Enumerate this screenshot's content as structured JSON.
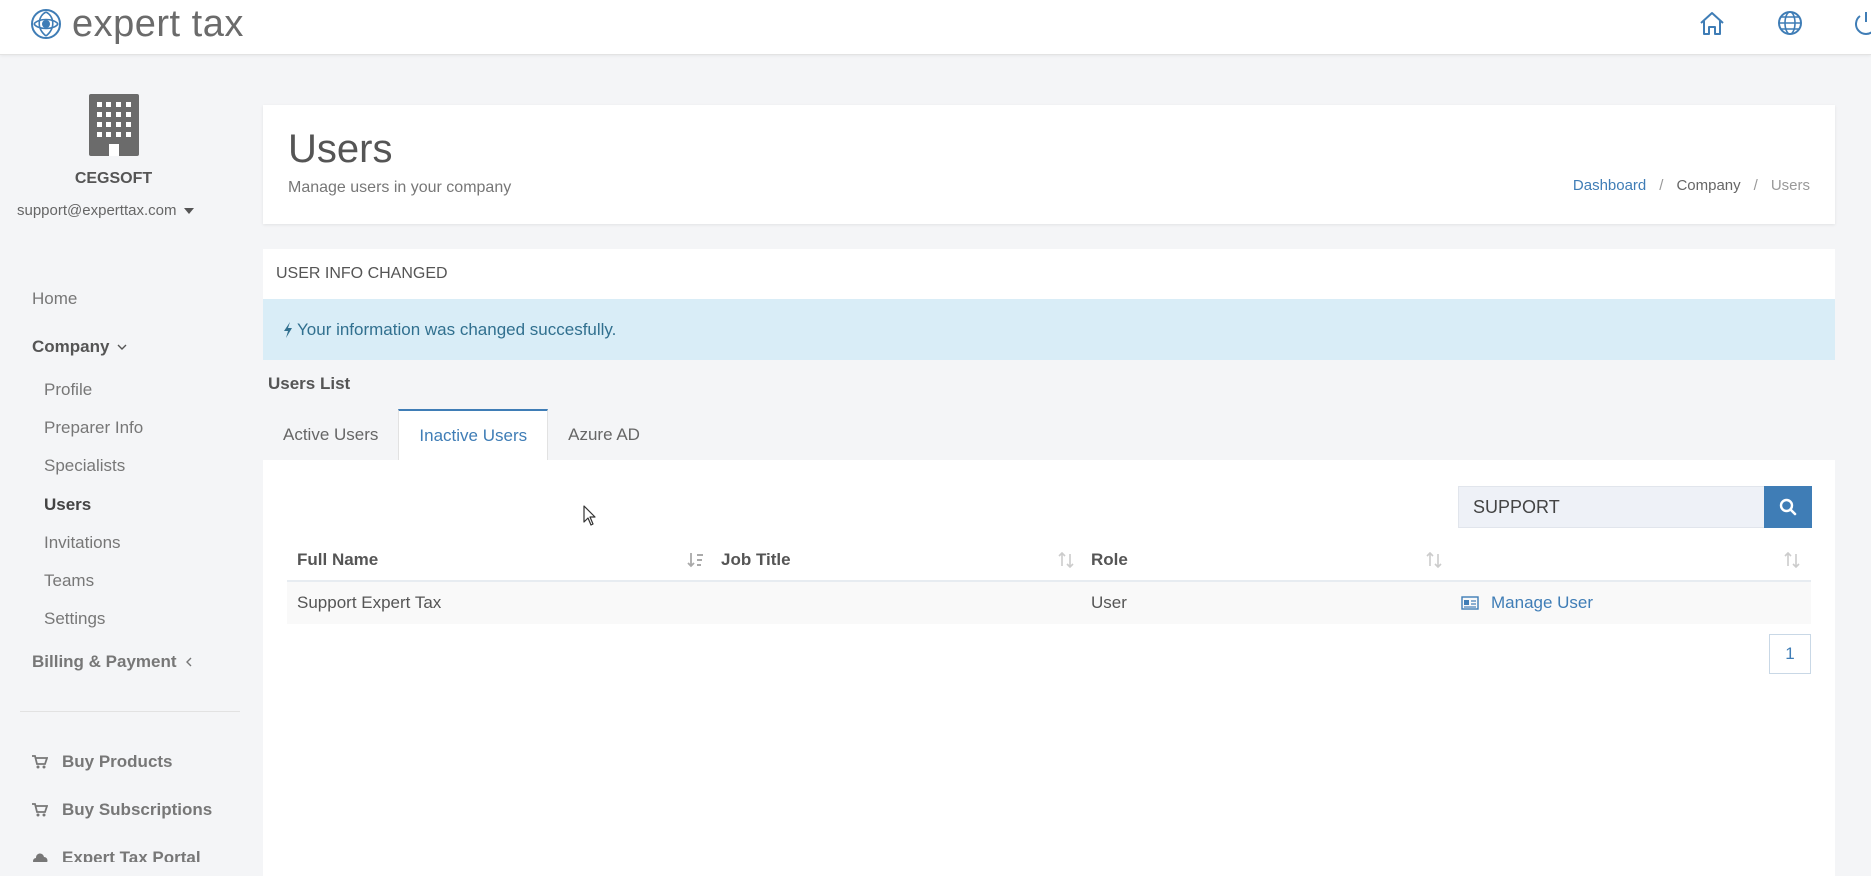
{
  "app": {
    "logo_text": "expert tax"
  },
  "sidebar": {
    "company_name": "CEGSOFT",
    "account_email": "support@experttax.com",
    "home_label": "Home",
    "company_label": "Company",
    "company_items": [
      {
        "label": "Profile"
      },
      {
        "label": "Preparer Info"
      },
      {
        "label": "Specialists"
      },
      {
        "label": "Users"
      },
      {
        "label": "Invitations"
      },
      {
        "label": "Teams"
      },
      {
        "label": "Settings"
      }
    ],
    "billing_label": "Billing & Payment",
    "buy_products_label": "Buy Products",
    "buy_subscriptions_label": "Buy Subscriptions",
    "portal_label": "Expert Tax Portal"
  },
  "header": {
    "title": "Users",
    "subtitle": "Manage users in your company",
    "breadcrumb": [
      "Dashboard",
      "Company",
      "Users"
    ],
    "breadcrumb_sep": "/"
  },
  "notice": {
    "title": "USER INFO CHANGED",
    "message": "Your information was changed succesfully."
  },
  "users_list": {
    "label": "Users List",
    "tabs": [
      {
        "label": "Active Users"
      },
      {
        "label": "Inactive Users"
      },
      {
        "label": "Azure AD"
      }
    ],
    "active_tab": "Inactive Users",
    "search_value": "SUPPORT",
    "columns": [
      "Full Name",
      "Job Title",
      "Role",
      ""
    ],
    "rows": [
      {
        "full_name": "Support Expert Tax",
        "job_title": "",
        "role": "User",
        "action": "Manage User"
      }
    ],
    "pages": [
      "1"
    ]
  },
  "colors": {
    "accent": "#3f7db6",
    "alert_bg": "#d9edf7",
    "alert_text": "#31708f"
  }
}
